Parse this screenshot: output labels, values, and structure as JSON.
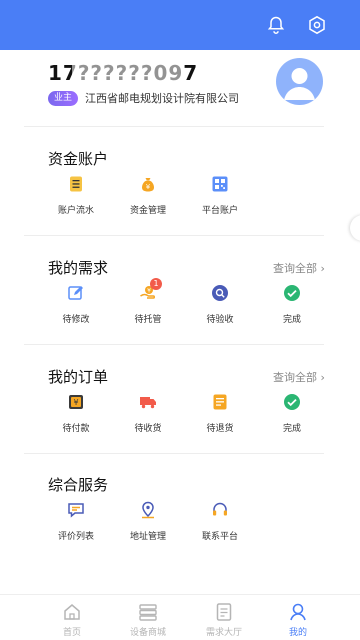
{
  "profile": {
    "phone": "17??????097",
    "badge": "业主",
    "company": "江西省邮电规划设计院有限公司"
  },
  "funds": {
    "title": "资金账户",
    "items": [
      {
        "label": "账户流水",
        "icon": "ledger-icon"
      },
      {
        "label": "资金管理",
        "icon": "money-bag-icon"
      },
      {
        "label": "平台账户",
        "icon": "qr-account-icon"
      }
    ]
  },
  "needs": {
    "title": "我的需求",
    "more": "查询全部",
    "items": [
      {
        "label": "待修改",
        "icon": "edit-icon"
      },
      {
        "label": "待托管",
        "icon": "hand-coin-icon",
        "badge": "1"
      },
      {
        "label": "待验收",
        "icon": "inspect-icon"
      },
      {
        "label": "完成",
        "icon": "check-circle-icon"
      }
    ]
  },
  "orders": {
    "title": "我的订单",
    "more": "查询全部",
    "items": [
      {
        "label": "待付款",
        "icon": "yen-wallet-icon"
      },
      {
        "label": "待收货",
        "icon": "truck-icon"
      },
      {
        "label": "待退货",
        "icon": "return-doc-icon"
      },
      {
        "label": "完成",
        "icon": "check-circle-icon"
      }
    ]
  },
  "services": {
    "title": "综合服务",
    "items": [
      {
        "label": "评价列表",
        "icon": "comment-icon"
      },
      {
        "label": "地址管理",
        "icon": "location-icon"
      },
      {
        "label": "联系平台",
        "icon": "headset-icon"
      }
    ]
  },
  "tabs": [
    {
      "label": "首页",
      "icon": "home-icon"
    },
    {
      "label": "设备商城",
      "icon": "store-icon"
    },
    {
      "label": "需求大厅",
      "icon": "document-icon"
    },
    {
      "label": "我的",
      "icon": "user-icon",
      "active": true
    }
  ],
  "colors": {
    "primary": "#4a7ef6",
    "badge_red": "#f25b4a",
    "green": "#2bb673",
    "orange": "#f5a623"
  }
}
